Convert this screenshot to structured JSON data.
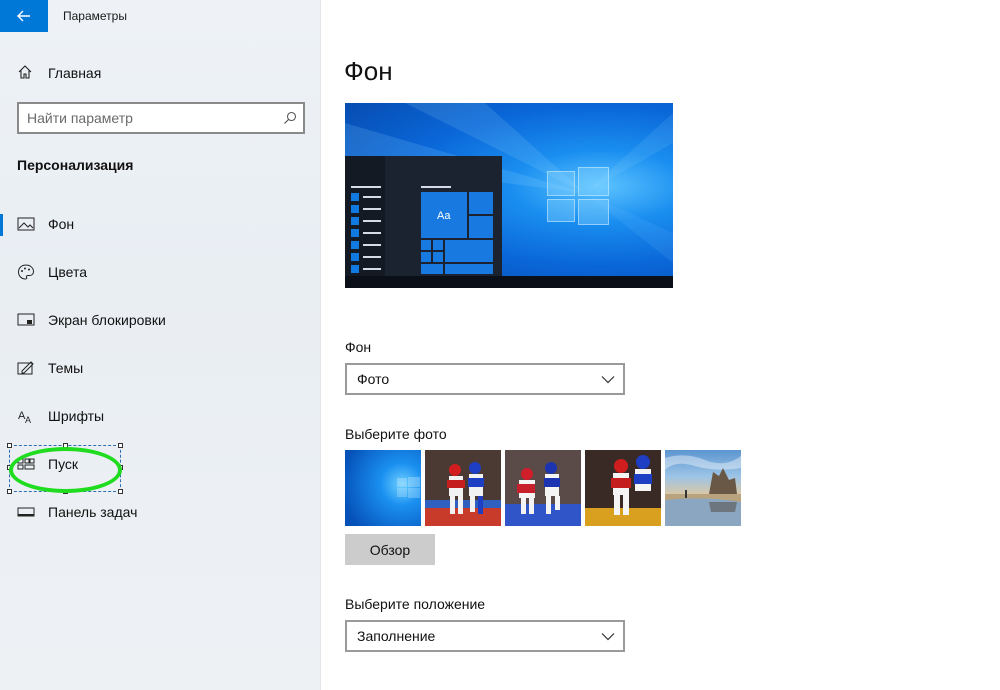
{
  "window": {
    "title": "Параметры"
  },
  "sidebar": {
    "home_label": "Главная",
    "search": {
      "placeholder": "Найти параметр",
      "value": ""
    },
    "section_title": "Персонализация",
    "items": [
      {
        "label": "Фон",
        "icon": "picture-icon",
        "selected": true
      },
      {
        "label": "Цвета",
        "icon": "palette-icon",
        "selected": false
      },
      {
        "label": "Экран блокировки",
        "icon": "lock-screen-icon",
        "selected": false
      },
      {
        "label": "Темы",
        "icon": "themes-icon",
        "selected": false
      },
      {
        "label": "Шрифты",
        "icon": "fonts-icon",
        "selected": false
      },
      {
        "label": "Пуск",
        "icon": "start-icon",
        "selected": false
      },
      {
        "label": "Панель задач",
        "icon": "taskbar-icon",
        "selected": false
      }
    ]
  },
  "main": {
    "title": "Фон",
    "preview": {
      "tile_text": "Aa"
    },
    "background": {
      "label": "Фон",
      "value": "Фото"
    },
    "choose_photo": {
      "label": "Выберите фото",
      "photos": [
        "windows-wallpaper",
        "taekwondo-1",
        "taekwondo-2",
        "taekwondo-3",
        "beach-rocks"
      ]
    },
    "browse_label": "Обзор",
    "position": {
      "label": "Выберите положение",
      "value": "Заполнение"
    }
  },
  "colors": {
    "accent": "#0078d7",
    "annotation": "#1fdc1f"
  }
}
